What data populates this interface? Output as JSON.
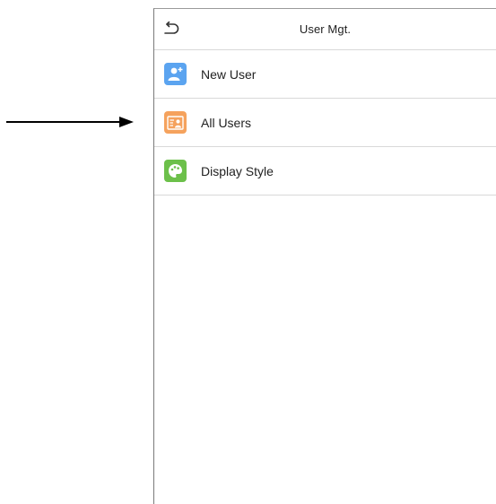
{
  "header": {
    "title": "User Mgt.",
    "back_icon": "back-arrow-icon"
  },
  "menu": {
    "items": [
      {
        "label": "New User",
        "icon": "add-user-icon",
        "icon_color": "#5ba4f0"
      },
      {
        "label": "All Users",
        "icon": "user-list-icon",
        "icon_color": "#f5a25d"
      },
      {
        "label": "Display Style",
        "icon": "palette-icon",
        "icon_color": "#6cc04a"
      }
    ]
  },
  "annotation": {
    "pointer": "arrow-right-icon"
  }
}
